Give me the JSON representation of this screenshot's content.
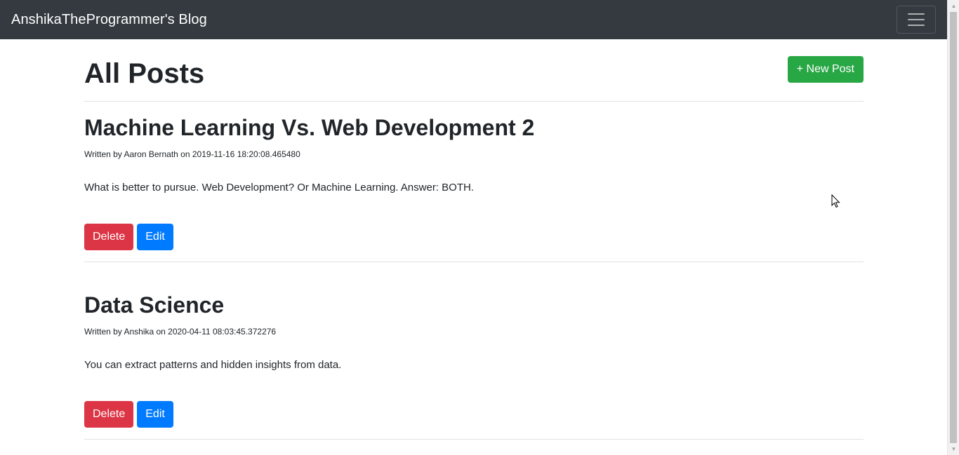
{
  "navbar": {
    "brand": "AnshikaTheProgrammer's Blog",
    "toggler_icon": "hamburger-menu-icon"
  },
  "page": {
    "title": "All Posts",
    "new_post_label": "+ New Post"
  },
  "posts": [
    {
      "title": "Machine Learning Vs. Web Development 2",
      "meta": "Written by Aaron Bernath on 2019-11-16 18:20:08.465480",
      "content": "What is better to pursue. Web Development? Or Machine Learning. Answer: BOTH.",
      "delete_label": "Delete",
      "edit_label": "Edit"
    },
    {
      "title": "Data Science",
      "meta": "Written by Anshika on 2020-04-11 08:03:45.372276",
      "content": "You can extract patterns and hidden insights from data.",
      "delete_label": "Delete",
      "edit_label": "Edit"
    }
  ],
  "colors": {
    "navbar_bg": "#343a40",
    "success": "#28a745",
    "danger": "#dc3545",
    "primary": "#007bff"
  }
}
